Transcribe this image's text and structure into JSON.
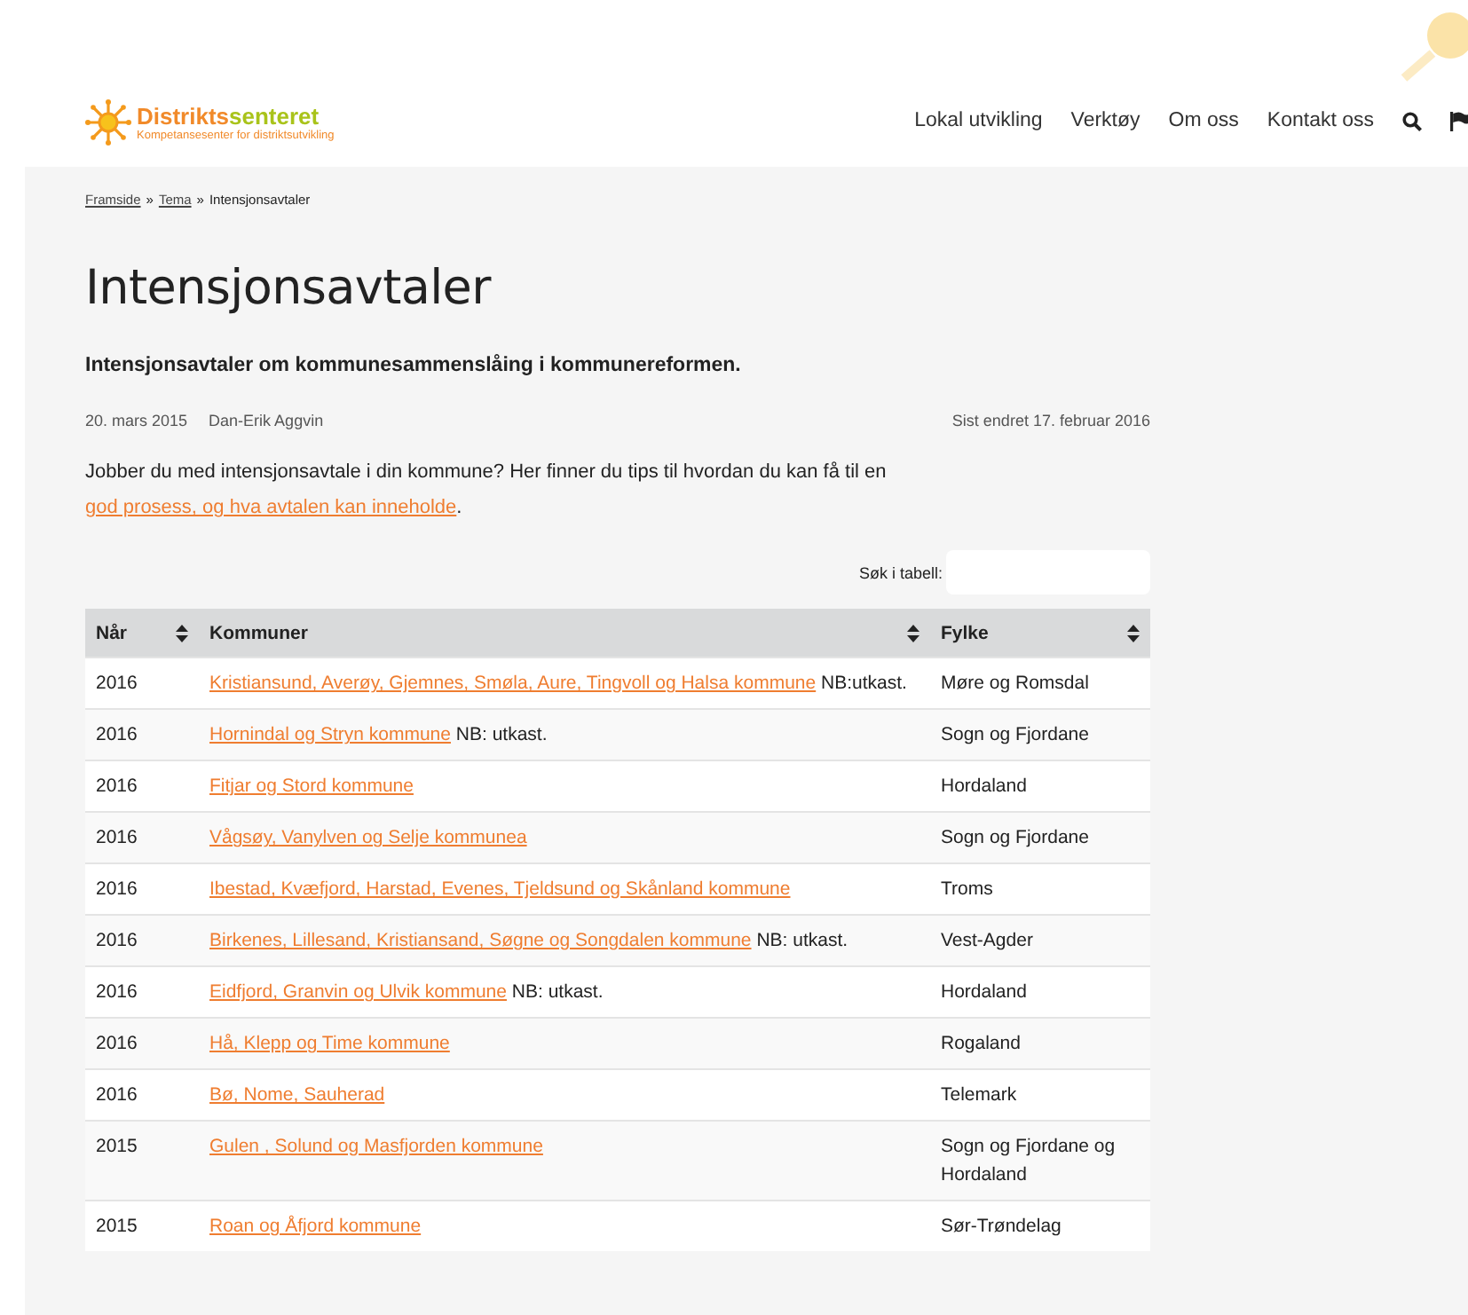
{
  "logo": {
    "name_part_1": "Distrikts",
    "name_part_2": "senteret",
    "tagline": "Kompetansesenter for distriktsutvikling"
  },
  "nav": [
    {
      "label": "Lokal utvikling"
    },
    {
      "label": "Verktøy"
    },
    {
      "label": "Om oss"
    },
    {
      "label": "Kontakt oss"
    }
  ],
  "breadcrumb": [
    {
      "label": "Framside",
      "kind": "link"
    },
    {
      "label": "»",
      "kind": "separator"
    },
    {
      "label": "Tema",
      "kind": "link"
    },
    {
      "label": "»",
      "kind": "separator"
    },
    {
      "label": "Intensjonsavtaler",
      "kind": "current"
    }
  ],
  "title": "Intensjonsavtaler",
  "lead": "Intensjonsavtaler om kommunesammenslåing i kommunereformen.",
  "published": "20. mars 2015",
  "author": "Dan-Erik Aggvin",
  "updated": "Sist endret 17. februar 2016",
  "intro": {
    "text": "Jobber du med intensjonsavtale i din kommune? Her finner du tips til hvordan du kan få til en ",
    "link": "god prosess, og hva avtalen kan inneholde",
    "after": "."
  },
  "table_search": {
    "label": "Søk i tabell:"
  },
  "table": {
    "columns": [
      "Når",
      "Kommuner",
      "Fylke"
    ],
    "rows": [
      {
        "year": "2016",
        "kommuner": "Kristiansund, Averøy, Gjemnes, Smøla, Aure, Tingvoll og Halsa kommune",
        "note": "NB:utkast.",
        "fylke": "Møre og Romsdal"
      },
      {
        "year": "2016",
        "kommuner": "Hornindal og Stryn kommune",
        "note": "NB: utkast.",
        "fylke": "Sogn og Fjordane"
      },
      {
        "year": "2016",
        "kommuner": "Fitjar og Stord kommune",
        "fylke": "Hordaland"
      },
      {
        "year": "2016",
        "kommuner": "Vågsøy, Vanylven og Selje kommunea",
        "fylke": "Sogn og Fjordane"
      },
      {
        "year": "2016",
        "kommuner": "Ibestad, Kvæfjord, Harstad, Evenes, Tjeldsund og Skånland kommune",
        "fylke": "Troms"
      },
      {
        "year": "2016",
        "kommuner": "Birkenes, Lillesand, Kristiansand, Søgne og Songdalen kommune",
        "note": "NB: utkast.",
        "fylke": "Vest-Agder"
      },
      {
        "year": "2016",
        "kommuner": "Eidfjord, Granvin og Ulvik kommune",
        "note": "NB: utkast.",
        "fylke": "Hordaland"
      },
      {
        "year": "2016",
        "kommuner": "Hå, Klepp og Time kommune",
        "fylke": "Rogaland"
      },
      {
        "year": "2016",
        "kommuner": "Bø, Nome, Sauherad",
        "fylke": "Telemark"
      },
      {
        "year": "2015",
        "kommuner": "Gulen , Solund og Masfjorden kommune",
        "fylke": "Sogn og Fjordane og Hordaland"
      },
      {
        "year": "2015",
        "kommuner": "Roan og Åfjord kommune",
        "fylke": "Sør-Trøndelag"
      }
    ]
  }
}
